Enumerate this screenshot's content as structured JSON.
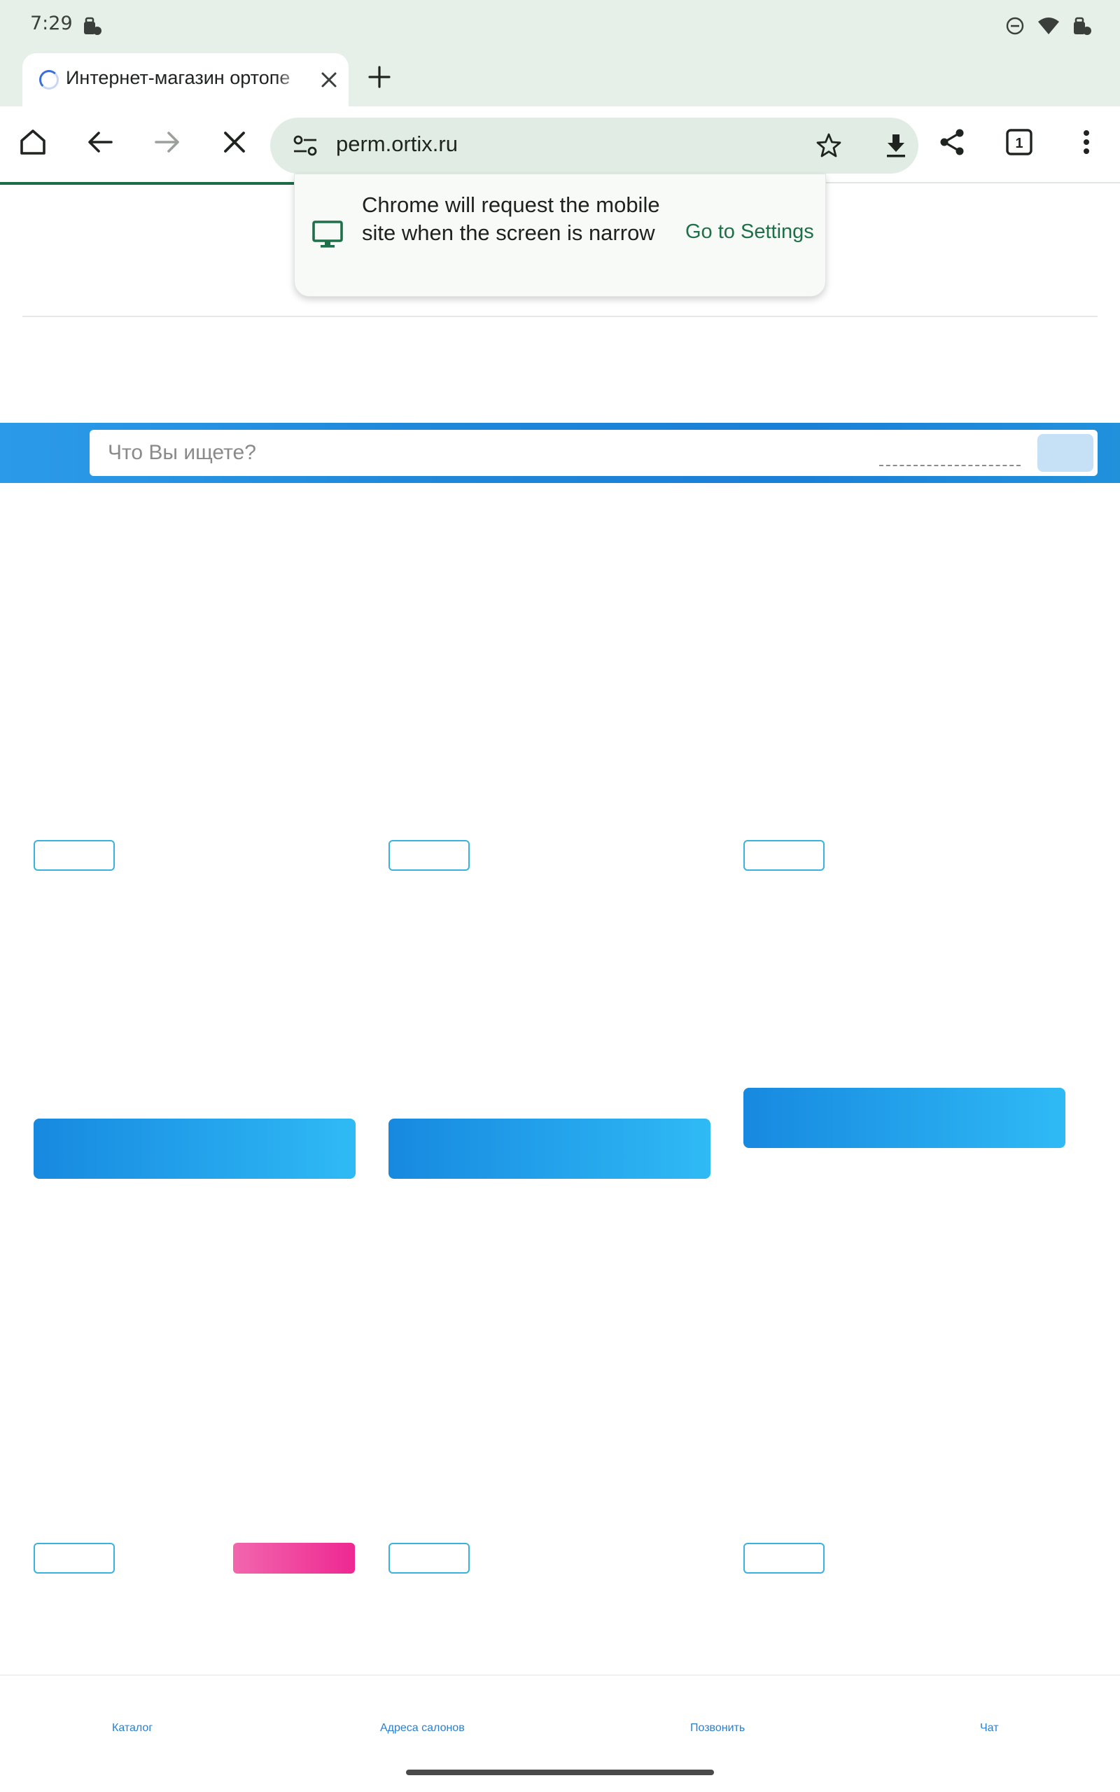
{
  "status_bar": {
    "time": "7:29",
    "icons": [
      "briefcase-icon",
      "dnd-icon",
      "wifi-icon",
      "battery-icon"
    ]
  },
  "tab": {
    "title": "Интернет-магазин ортопе",
    "spinner_icon": "loading-spinner-icon",
    "close_icon": "close-icon",
    "new_tab_icon": "plus-icon"
  },
  "toolbar": {
    "icons": [
      "home-icon",
      "back-arrow-icon",
      "forward-arrow-icon",
      "stop-icon",
      "share-icon",
      "tabs-count-icon",
      "more-vert-icon"
    ],
    "tab_count": "1"
  },
  "omnibox": {
    "url": "perm.ortix.ru",
    "icons": [
      "site-settings-icon",
      "star-icon",
      "download-icon"
    ]
  },
  "popup": {
    "message": "Chrome will request the mobile site when the screen is narrow",
    "action": "Go to Settings",
    "icon": "desktop-monitor-icon"
  },
  "search": {
    "placeholder": "Что Вы ищете?"
  },
  "bottom_nav": {
    "items": [
      {
        "label": "Каталог"
      },
      {
        "label": "Адреса салонов"
      },
      {
        "label": "Позвонить"
      },
      {
        "label": "Чат"
      }
    ]
  },
  "colors": {
    "chrome_bg": "#e6efe8",
    "accent_green": "#1e7048",
    "brand_blue": "#1f86d8",
    "outline_blue": "#39b2df",
    "pink": "#ee2892"
  }
}
